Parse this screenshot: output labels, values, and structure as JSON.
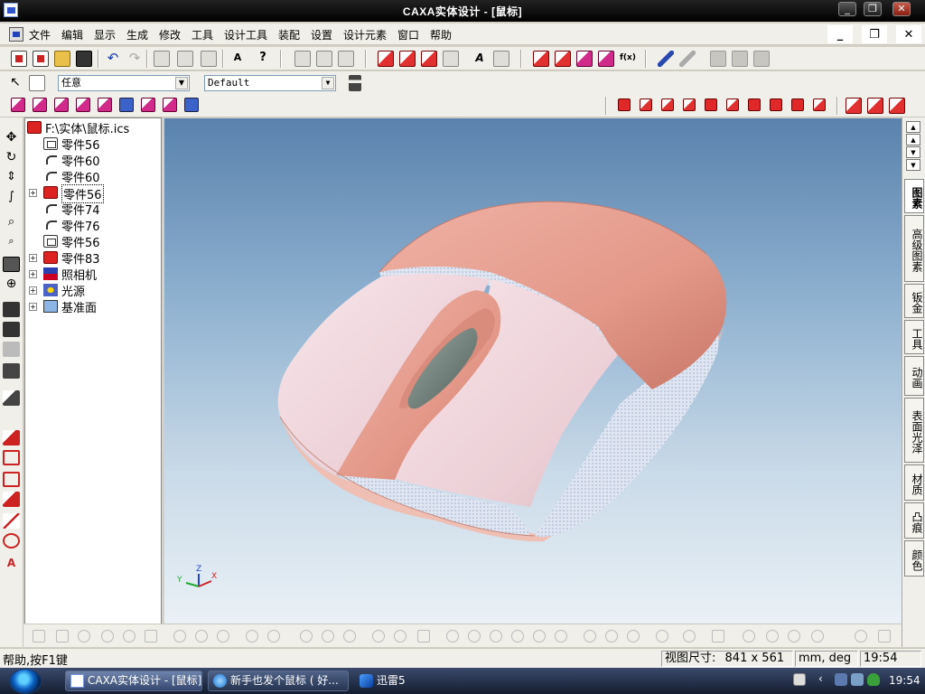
{
  "window": {
    "title": "CAXA实体设计 - [鼠标]",
    "controls": {
      "min": "_",
      "max": "❐",
      "close": "✕"
    }
  },
  "menubar": {
    "items": [
      "文件",
      "编辑",
      "显示",
      "生成",
      "修改",
      "工具",
      "设计工具",
      "装配",
      "设置",
      "设计元素",
      "窗口",
      "帮助"
    ],
    "mdi": {
      "min": "_",
      "restore": "❐",
      "close": "✕"
    }
  },
  "toolbar": {
    "selection_filter": "任意",
    "style_combo": "Default"
  },
  "tree": {
    "root": "F:\\实体\\鼠标.ics",
    "nodes": [
      {
        "label": "零件56",
        "icon": "part",
        "expand": false
      },
      {
        "label": "零件60",
        "icon": "sketch",
        "expand": false
      },
      {
        "label": "零件60",
        "icon": "sketch",
        "expand": false
      },
      {
        "label": "零件56",
        "icon": "red-part",
        "expand": true
      },
      {
        "label": "零件74",
        "icon": "sketch",
        "expand": false
      },
      {
        "label": "零件76",
        "icon": "sketch",
        "expand": false
      },
      {
        "label": "零件56",
        "icon": "part",
        "expand": false
      },
      {
        "label": "零件83",
        "icon": "red-part",
        "expand": true
      },
      {
        "label": "照相机",
        "icon": "camera",
        "expand": true
      },
      {
        "label": "光源",
        "icon": "light",
        "expand": true
      },
      {
        "label": "基准面",
        "icon": "plane",
        "expand": true
      }
    ]
  },
  "viewport": {
    "axis": {
      "x": "X",
      "y": "Y",
      "z": "Z"
    },
    "colors": {
      "shell": "#e8a193",
      "light": "#f2d6dc",
      "wheel": "#6b7d76",
      "bg_top": "#5a82ad",
      "bg_bottom": "#eaf1f6"
    }
  },
  "right_tabs": [
    "图素",
    "高级图素",
    "钣金",
    "工具",
    "动画",
    "表面光泽",
    "材质",
    "凸痕",
    "颜色"
  ],
  "status": {
    "help": "帮助,按F1键",
    "view_size_label": "视图尺寸:",
    "view_size_value": "841 x 561",
    "units": "mm, deg",
    "time": "19:54"
  },
  "taskbar": {
    "tasks": [
      {
        "label": "CAXA实体设计 - [鼠标]"
      },
      {
        "label": "新手也发个鼠标 ( 好..."
      },
      {
        "label": "迅雷5"
      }
    ],
    "clock": "19:54"
  }
}
